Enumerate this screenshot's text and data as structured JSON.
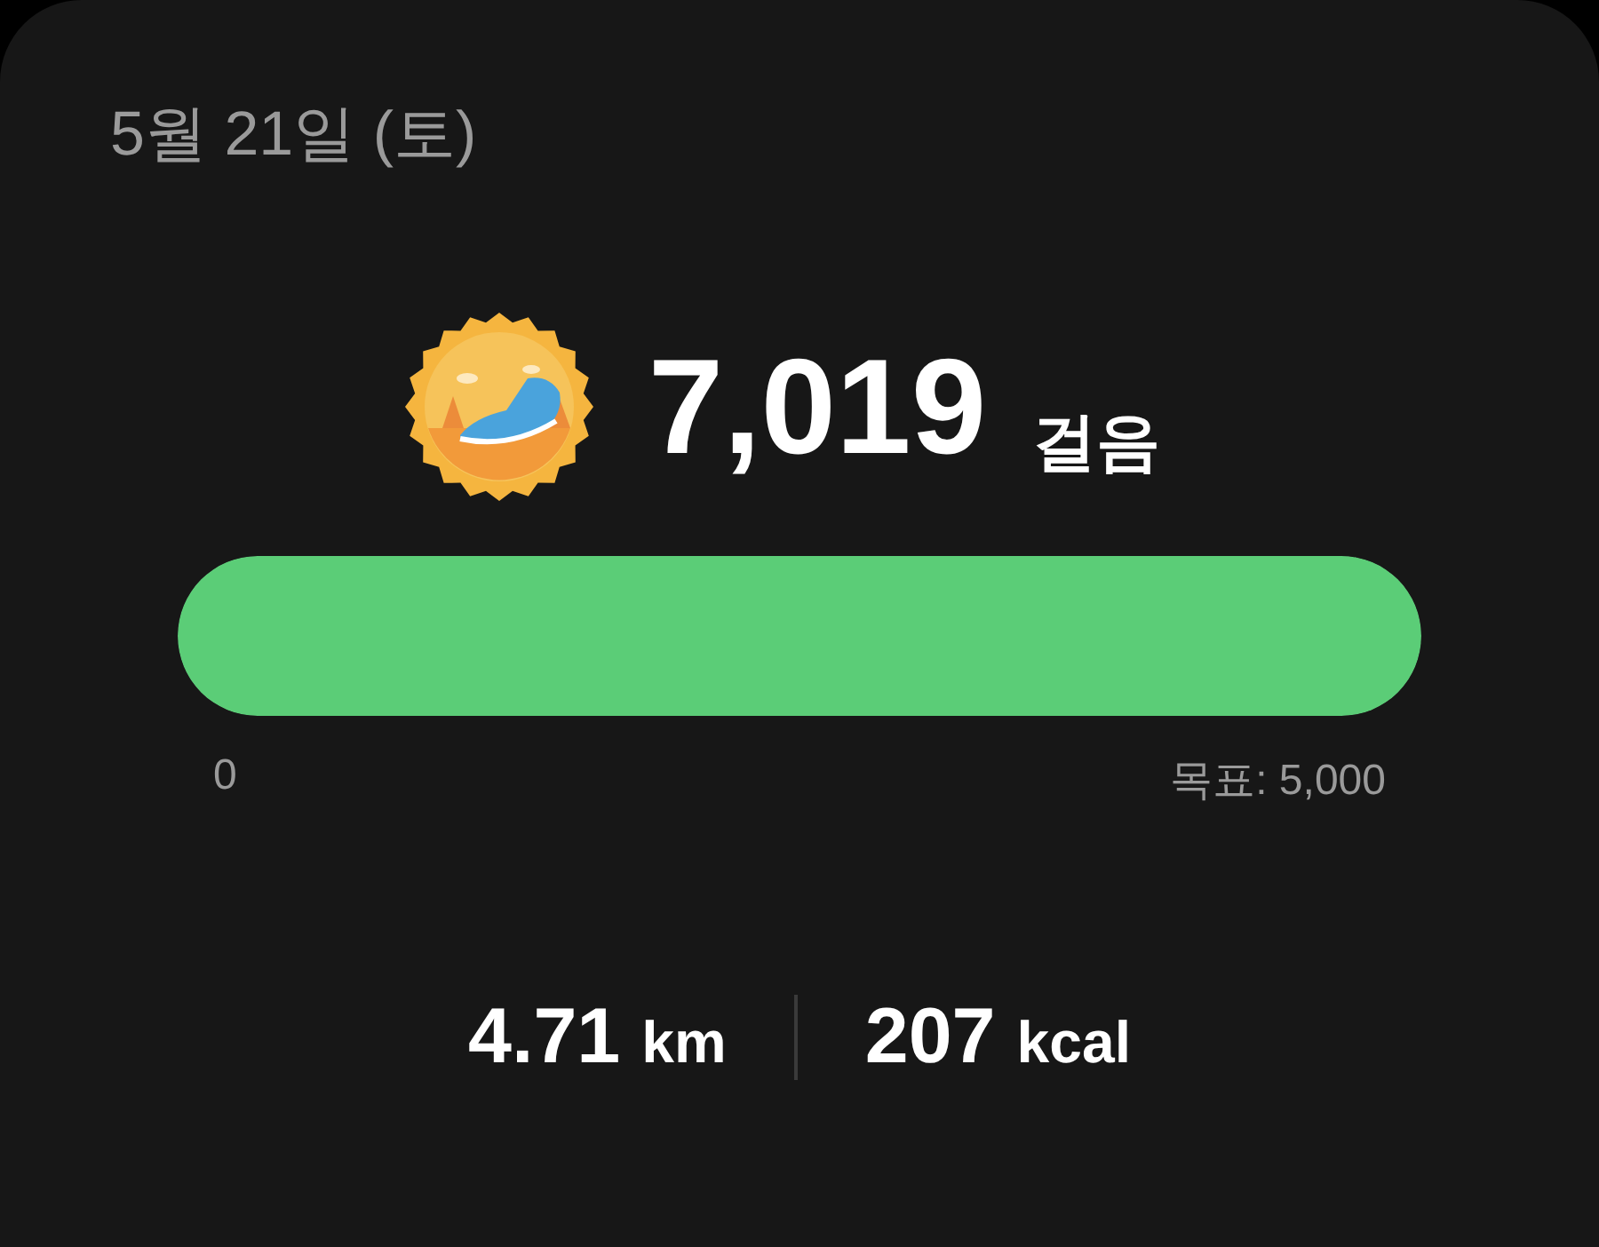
{
  "date": "5월 21일 (토)",
  "steps": {
    "value": "7,019",
    "unit": "걸음"
  },
  "progress": {
    "level": 1,
    "start_label": "0",
    "goal_label": "목표: 5,000"
  },
  "stats": [
    {
      "value": "4.71",
      "unit": "km"
    },
    {
      "value": "207",
      "unit": "kcal"
    }
  ]
}
